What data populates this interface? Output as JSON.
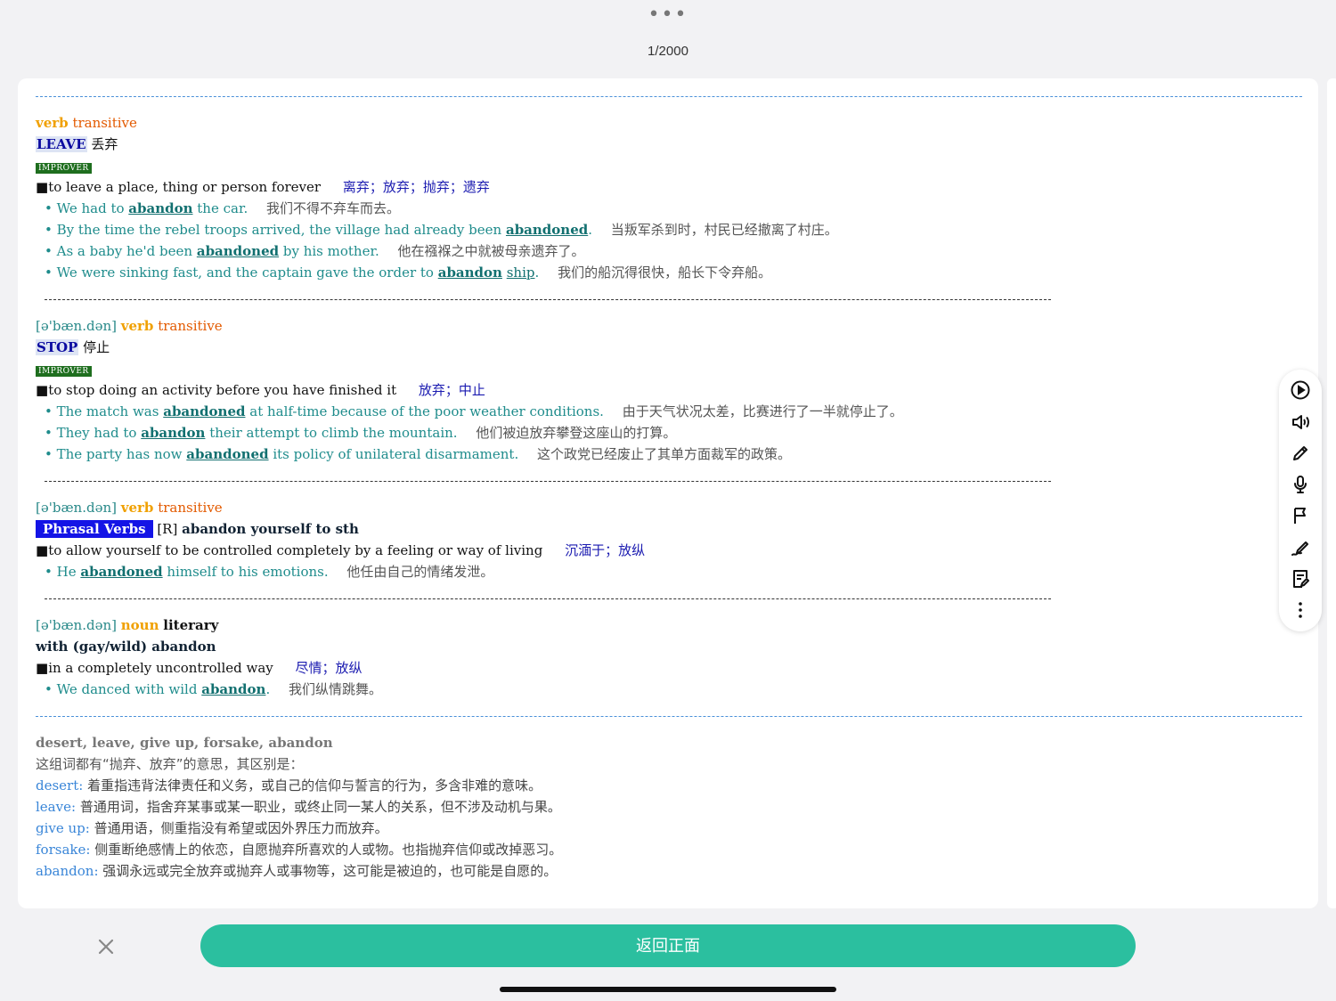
{
  "header": {
    "more_label": "•••",
    "counter": "1/2000"
  },
  "senses": [
    {
      "pron": "",
      "pos": "verb",
      "gram": "transitive",
      "guide": "LEAVE",
      "guide_cn": "丢弃",
      "level": "IMPROVER",
      "def": "to leave a place, thing or person forever",
      "def_cn": "离弃；放弃；抛弃；遗弃",
      "examples": [
        {
          "pre": "We had to ",
          "kw": "abandon",
          "post": " the car.",
          "cn": "我们不得不弃车而去。"
        },
        {
          "pre": "By the time the rebel troops arrived, the village had already been ",
          "kw": "abandoned",
          "post": ".",
          "cn": "当叛军杀到时，村民已经撤离了村庄。"
        },
        {
          "pre": "As a baby he'd been ",
          "kw": "abandoned",
          "post": " by his mother.",
          "cn": "他在襁褓之中就被母亲遗弃了。"
        },
        {
          "pre": "We were sinking fast, and the captain gave the order to ",
          "kw": "abandon",
          "link": "ship",
          "post": ".",
          "cn": "我们的船沉得很快，船长下令弃船。"
        }
      ]
    },
    {
      "pron": "[ə'bæn.dən]",
      "pos": "verb",
      "gram": "transitive",
      "guide": "STOP",
      "guide_cn": "停止",
      "level": "IMPROVER",
      "def": "to stop doing an activity before you have finished it",
      "def_cn": "放弃；中止",
      "examples": [
        {
          "pre": "The match was ",
          "kw": "abandoned",
          "post": " at half-time because of the poor weather conditions.",
          "cn": "由于天气状况太差，比赛进行了一半就停止了。"
        },
        {
          "pre": "They had to ",
          "kw": "abandon",
          "post": " their attempt to climb the mountain.",
          "cn": "他们被迫放弃攀登这座山的打算。"
        },
        {
          "pre": "The party has now ",
          "kw": "abandoned",
          "post": " its policy of unilateral disarmament.",
          "cn": "这个政党已经废止了其单方面裁军的政策。"
        }
      ]
    },
    {
      "pron": "[ə'bæn.dən]",
      "pos": "verb",
      "gram": "transitive",
      "pv_label": "Phrasal Verbs",
      "reg": "[R]",
      "phrase": "abandon yourself to sth",
      "def": "to allow yourself to be controlled completely by a feeling or way of living",
      "def_cn": "沉湎于；放纵",
      "examples": [
        {
          "pre": "He ",
          "kw": "abandoned",
          "post": " himself to his emotions.",
          "cn": "他任由自己的情绪发泄。"
        }
      ]
    },
    {
      "pron": "[ə'bæn.dən]",
      "pos": "noun",
      "gram": "literary",
      "phrase": "with (gay/wild) abandon",
      "def": "in a completely uncontrolled way",
      "def_cn": "尽情；放纵",
      "examples": [
        {
          "pre": "We danced with wild ",
          "kw": "abandon",
          "post": ".",
          "cn": "我们纵情跳舞。"
        }
      ]
    }
  ],
  "synonyms": {
    "title": "desert, leave, give up, forsake, abandon",
    "intro": "这组词都有“抛弃、放弃”的意思，其区别是：",
    "items": [
      {
        "word": "desert:",
        "desc": "着重指违背法律责任和义务，或自己的信仰与誓言的行为，多含非难的意味。"
      },
      {
        "word": "leave:",
        "desc": "普通用词，指舍弃某事或某一职业，或终止同一某人的关系，但不涉及动机与果。"
      },
      {
        "word": "give up:",
        "desc": "普通用语，侧重指没有希望或因外界压力而放弃。"
      },
      {
        "word": "forsake:",
        "desc": "侧重断绝感情上的依恋，自愿抛弃所喜欢的人或物。也指抛弃信仰或改掉恶习。"
      },
      {
        "word": "abandon:",
        "desc": "强调永远或完全放弃或抛弃人或事物等，这可能是被迫的，也可能是自愿的。"
      }
    ]
  },
  "bottom": {
    "back_label": "返回正面"
  },
  "colors": {
    "accent": "#2bbf9f",
    "example": "#1f8c8c",
    "pos": "#f0a000",
    "gram": "#e35a00"
  }
}
